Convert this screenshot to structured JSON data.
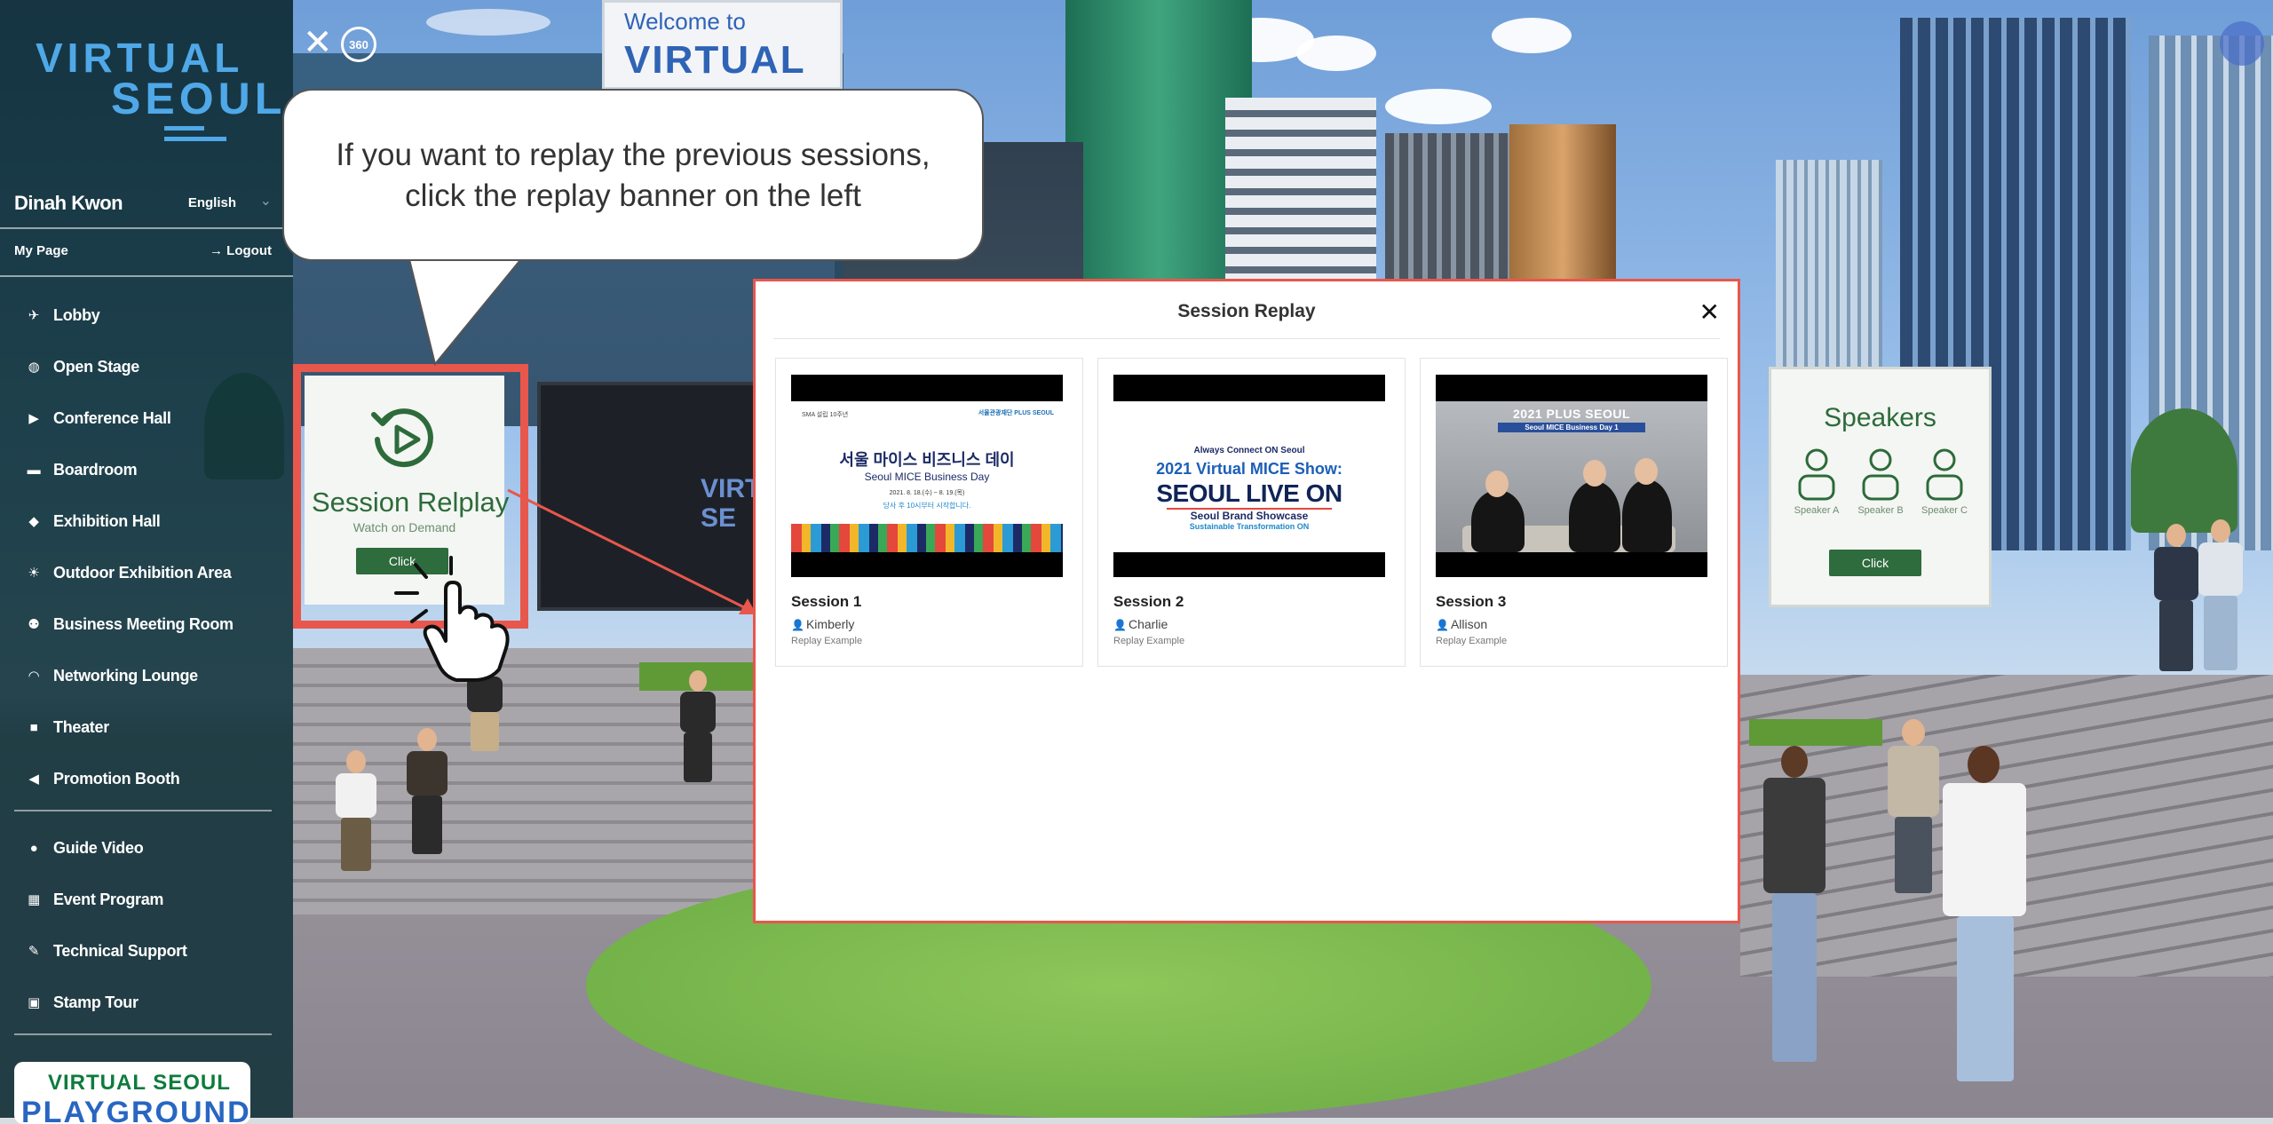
{
  "scene": {
    "welcome_sign": {
      "line1": "Welcome to",
      "line2": "VIRTUAL"
    },
    "screen_text": "VIRTU\nSE"
  },
  "sidebar": {
    "logo": {
      "line1": "VIRTUAL",
      "line2": "SEOUL"
    },
    "user_name": "Dinah Kwon",
    "language": "English",
    "my_page": "My Page",
    "logout": "→ Logout",
    "nav_main": [
      {
        "label": "Lobby",
        "icon": "plane-icon"
      },
      {
        "label": "Open Stage",
        "icon": "globe-icon"
      },
      {
        "label": "Conference Hall",
        "icon": "play-icon"
      },
      {
        "label": "Boardroom",
        "icon": "briefcase-icon"
      },
      {
        "label": "Exhibition Hall",
        "icon": "cube-icon"
      },
      {
        "label": "Outdoor Exhibition Area",
        "icon": "sun-icon"
      },
      {
        "label": "Business Meeting Room",
        "icon": "users-icon"
      },
      {
        "label": "Networking Lounge",
        "icon": "wifi-icon"
      },
      {
        "label": "Theater",
        "icon": "video-icon"
      },
      {
        "label": "Promotion Booth",
        "icon": "megaphone-icon"
      }
    ],
    "nav_support": [
      {
        "label": "Guide Video",
        "icon": "question-icon"
      },
      {
        "label": "Event Program",
        "icon": "calendar-icon"
      },
      {
        "label": "Technical Support",
        "icon": "wrench-icon"
      },
      {
        "label": "Stamp Tour",
        "icon": "gift-icon"
      }
    ],
    "playground": {
      "line1": "VIRTUAL SEOUL",
      "line2": "PLAYGROUND"
    }
  },
  "controls": {
    "close_label": "✕",
    "view_360_label": "360"
  },
  "callout": {
    "line1": "If you want to replay the previous sessions,",
    "line2": "click the replay banner on the left"
  },
  "replay_banner": {
    "title": "Session Relplay",
    "subtitle": "Watch on Demand",
    "button": "Click"
  },
  "speakers_board": {
    "title": "Speakers",
    "speakers": [
      "Speaker A",
      "Speaker B",
      "Speaker C"
    ],
    "button": "Click"
  },
  "modal": {
    "title": "Session Replay",
    "close_label": "✕",
    "sessions": [
      {
        "title": "Session 1",
        "speaker": "Kimberly",
        "description": "Replay Example",
        "thumbnail": {
          "header_left": "SMA 설립 10주년",
          "header_right": "서울관광재단  PLUS SEOUL",
          "title_ko": "서울 마이스 비즈니스 데이",
          "title_en": "Seoul MICE Business Day",
          "date": "2021. 8. 18.(수) ~ 8. 19.(목)",
          "time_note": "당사 후 10시부터 시작합니다."
        }
      },
      {
        "title": "Session 2",
        "speaker": "Charlie",
        "description": "Replay Example",
        "thumbnail": {
          "tagline": "Always Connect ON Seoul",
          "title": "2021 Virtual MICE Show:",
          "headline": "SEOUL LIVE ON",
          "sub1": "Seoul Brand Showcase",
          "sub2": "Sustainable Transformation ON"
        }
      },
      {
        "title": "Session 3",
        "speaker": "Allison",
        "description": "Replay Example",
        "thumbnail": {
          "title": "2021 PLUS SEOUL",
          "subtitle": "Seoul MICE Business Day 1"
        }
      }
    ]
  },
  "colors": {
    "highlight": "#e8574c",
    "banner_green": "#2e6b3d",
    "sidebar_bg": "#12303c",
    "logo_blue": "#4fa8e8"
  }
}
